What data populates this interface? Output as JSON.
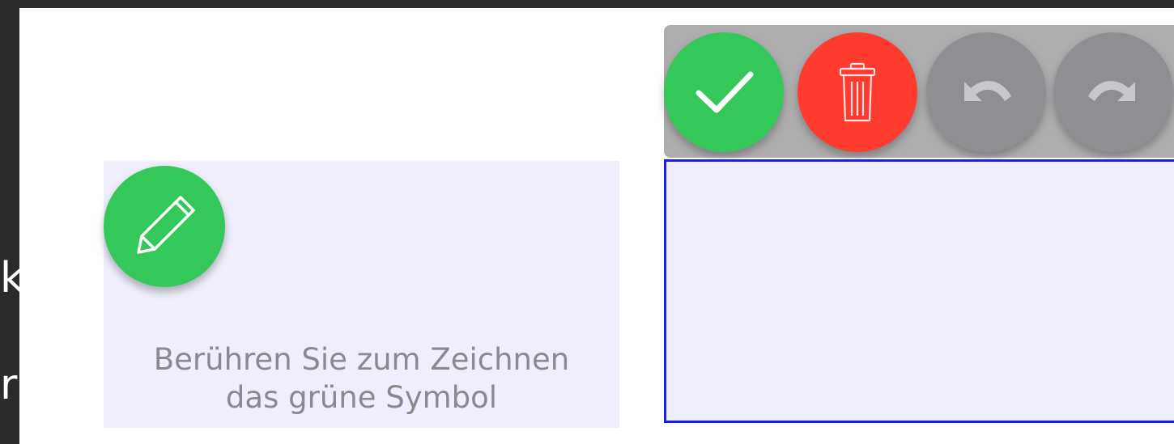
{
  "background_edge": {
    "line1": "ko",
    "line2": "r"
  },
  "draw_card": {
    "hint_line1": "Berühren Sie zum Zeichnen",
    "hint_line2": "das grüne Symbol",
    "pencil_icon": "pencil-icon"
  },
  "toolbar": {
    "buttons": [
      {
        "icon": "checkmark-icon",
        "color": "#34c759"
      },
      {
        "icon": "trash-icon",
        "color": "#ff3b30"
      },
      {
        "icon": "undo-icon",
        "color": "#8e8e93"
      },
      {
        "icon": "redo-icon",
        "color": "#8e8e93"
      }
    ]
  },
  "colors": {
    "canvas_background": "#eeeefc",
    "canvas_border": "#1d1de8",
    "toolbar_background": "#adadad",
    "hint_text": "#8a8a8e"
  }
}
